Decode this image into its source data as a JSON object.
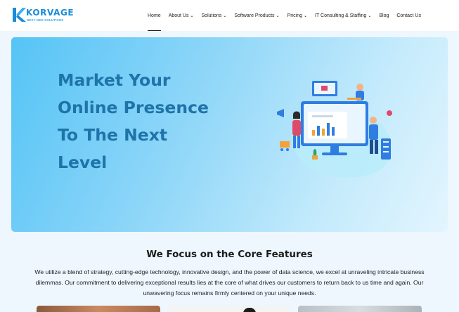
{
  "brand": {
    "name": "KORVAGE",
    "tagline": "NEXT-GEN SOLUTIONS",
    "logo_color": "#1a8cd8"
  },
  "nav": {
    "items": [
      {
        "label": "Home",
        "active": true,
        "dropdown": false
      },
      {
        "label": "About Us",
        "active": false,
        "dropdown": true
      },
      {
        "label": "Solutions",
        "active": false,
        "dropdown": true
      },
      {
        "label": "Software Products",
        "active": false,
        "dropdown": true
      },
      {
        "label": "Pricing",
        "active": false,
        "dropdown": true
      },
      {
        "label": "IT Consulting & Staffing",
        "active": false,
        "dropdown": true
      },
      {
        "label": "Blog",
        "active": false,
        "dropdown": false
      },
      {
        "label": "Contact Us",
        "active": false,
        "dropdown": false
      }
    ],
    "chevron_icon": "chevron-down-icon"
  },
  "hero": {
    "title_lines": [
      "Market Your",
      "Online Presence",
      "To The Next",
      "Level"
    ],
    "title_color": "#1e73a8",
    "illustration_icon": "digital-marketing-illustration"
  },
  "features": {
    "title": "We Focus on the Core Features",
    "description": "We utilize a blend of strategy, cutting-edge technology, innovative design, and the power of data science, we excel at unraveling intricate business dilemmas. Our commitment to delivering exceptional results lies at the core of what drives our customers to return back to us time and again. Our unwavering focus remains firmly centered on your unique needs."
  },
  "colors": {
    "accent": "#1a8cd8",
    "hero_gradient_start": "#55c4f6",
    "hero_gradient_end": "#e3f5fe",
    "page_background": "#eef7fd"
  }
}
